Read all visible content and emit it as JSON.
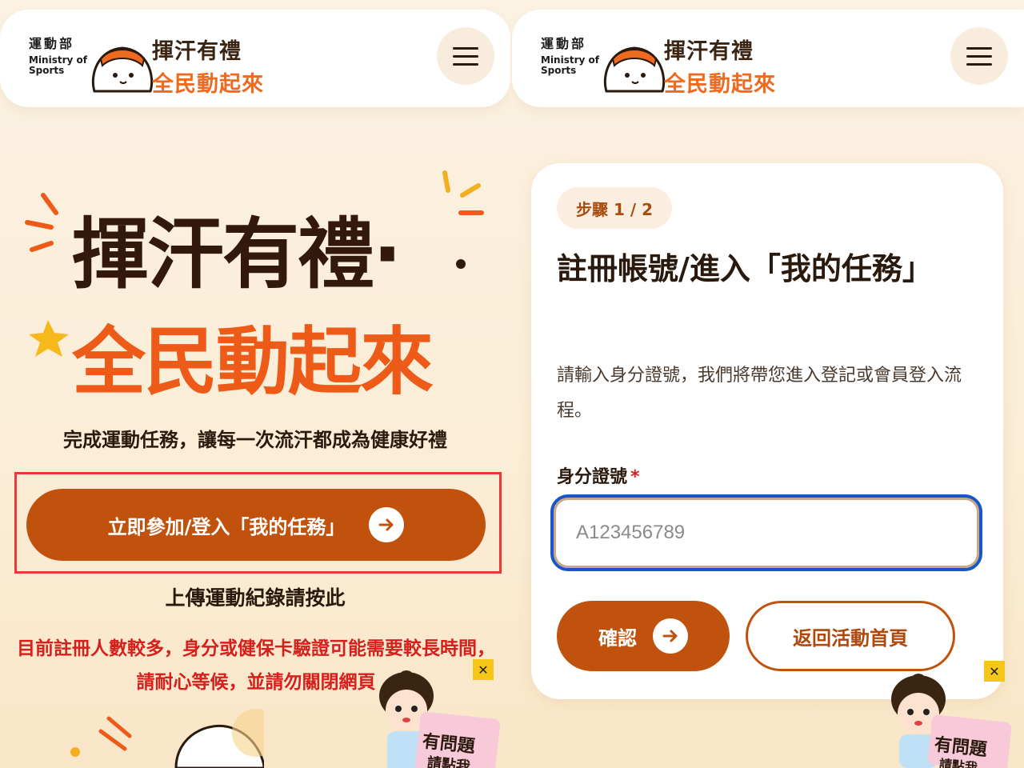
{
  "brand": {
    "ministry_zh": "運動部",
    "ministry_en_1": "Ministry of",
    "ministry_en_2": "Sports",
    "logo_line1": "揮汗有禮",
    "logo_line2": "全民動起來"
  },
  "left": {
    "hero_title_1": "揮汗有禮·",
    "hero_title_2": "全民動起來",
    "subtitle": "完成運動任務，讓每一次流汗都成為健康好禮",
    "cta_label": "立即參加/登入「我的任務」",
    "upload_link": "上傳運動紀錄請按此",
    "notice": "目前註冊人數較多，身分或健保卡驗證可能需要較長時間，請耐心等候，並請勿關閉網頁"
  },
  "helper": {
    "label_1": "有問題",
    "label_2": "請點我",
    "close": "✕"
  },
  "form": {
    "step": "步驟 1 / 2",
    "title": "註冊帳號/進入「我的任務」",
    "description": "請輸入身分證號，我們將帶您進入登記或會員登入流程。",
    "id_label": "身分證號",
    "required_mark": "*",
    "id_placeholder": "A123456789",
    "confirm_label": "確認",
    "back_label": "返回活動首頁"
  },
  "colors": {
    "accent": "#c0520e",
    "title_brown": "#33190a",
    "title_orange": "#ee5a18",
    "notice_red": "#d6201c",
    "input_focus": "#1a56c8"
  },
  "icons": [
    "menu-icon",
    "arrow-right-icon",
    "close-icon",
    "mascot-logo"
  ]
}
